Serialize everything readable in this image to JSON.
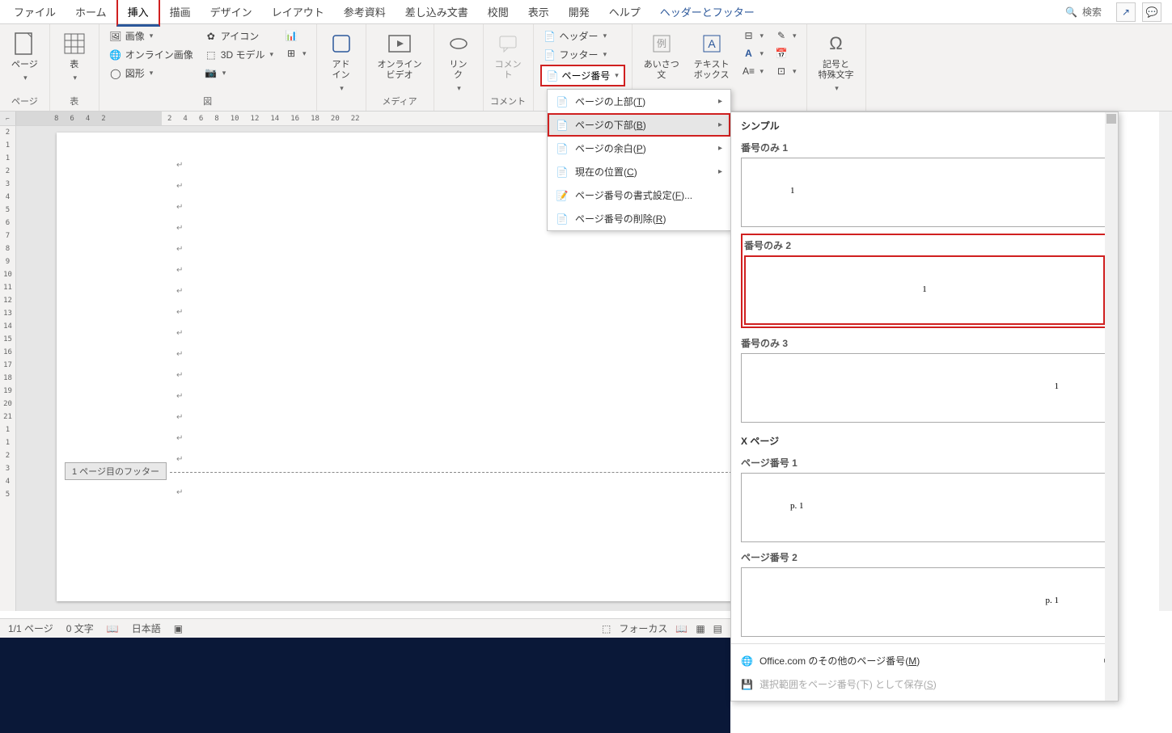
{
  "tabs": {
    "file": "ファイル",
    "home": "ホーム",
    "insert": "挿入",
    "draw": "描画",
    "design": "デザイン",
    "layout": "レイアウト",
    "references": "参考資料",
    "mailings": "差し込み文書",
    "review": "校閲",
    "view": "表示",
    "developer": "開発",
    "help": "ヘルプ",
    "header_footer": "ヘッダーとフッター",
    "search": "検索"
  },
  "ribbon": {
    "pages": {
      "label": "ページ",
      "group": "ページ"
    },
    "tables": {
      "label": "表",
      "group": "表"
    },
    "illustrations": {
      "picture": "画像",
      "icons": "アイコン",
      "online_pic": "オンライン画像",
      "model3d": "3D モデル",
      "shapes": "図形",
      "group": "図"
    },
    "addins": {
      "label": "アド\nイン",
      "group": ""
    },
    "media": {
      "label": "オンライン\nビデオ",
      "group": "メディア"
    },
    "links": {
      "label": "リン\nク",
      "group": ""
    },
    "comments": {
      "label": "コメン\nト",
      "group": "コメント"
    },
    "header_footer": {
      "header": "ヘッダー",
      "footer": "フッター",
      "page_num": "ページ番号",
      "group": ""
    },
    "text": {
      "greeting": "あいさつ\n文",
      "textbox": "テキスト\nボックス",
      "group": ""
    },
    "symbols": {
      "label": "記号と\n特殊文字",
      "group": ""
    }
  },
  "page_num_menu": {
    "top": "ページの上部",
    "top_key": "T",
    "bottom": "ページの下部",
    "bottom_key": "B",
    "margin": "ページの余白",
    "margin_key": "P",
    "current": "現在の位置",
    "current_key": "C",
    "format": "ページ番号の書式設定",
    "format_key": "F",
    "remove": "ページ番号の削除",
    "remove_key": "R"
  },
  "gallery": {
    "section1": "シンプル",
    "item1": "番号のみ 1",
    "item2": "番号のみ 2",
    "item3": "番号のみ 3",
    "section2": "X ページ",
    "item4": "ページ番号 1",
    "item4_preview": "p. 1",
    "item5": "ページ番号 2",
    "item5_preview": "p. 1",
    "preview_num": "1",
    "more": "Office.com のその他のページ番号",
    "more_key": "M",
    "save": "選択範囲をページ番号(下) として保存",
    "save_key": "S"
  },
  "document": {
    "footer_tab": "1 ページ目のフッター"
  },
  "ruler_h": [
    "8",
    "6",
    "4",
    "2",
    "2",
    "4",
    "6",
    "8",
    "10",
    "12",
    "14",
    "16",
    "18",
    "20",
    "22"
  ],
  "ruler_v": [
    "2",
    "1",
    "1",
    "2",
    "3",
    "4",
    "5",
    "6",
    "7",
    "8",
    "9",
    "10",
    "11",
    "12",
    "13",
    "14",
    "15",
    "16",
    "17",
    "18",
    "19",
    "20",
    "21",
    "1",
    "1",
    "2",
    "3",
    "4",
    "5"
  ],
  "status": {
    "page": "1/1 ページ",
    "words": "0 文字",
    "lang": "日本語",
    "focus": "フォーカス"
  }
}
